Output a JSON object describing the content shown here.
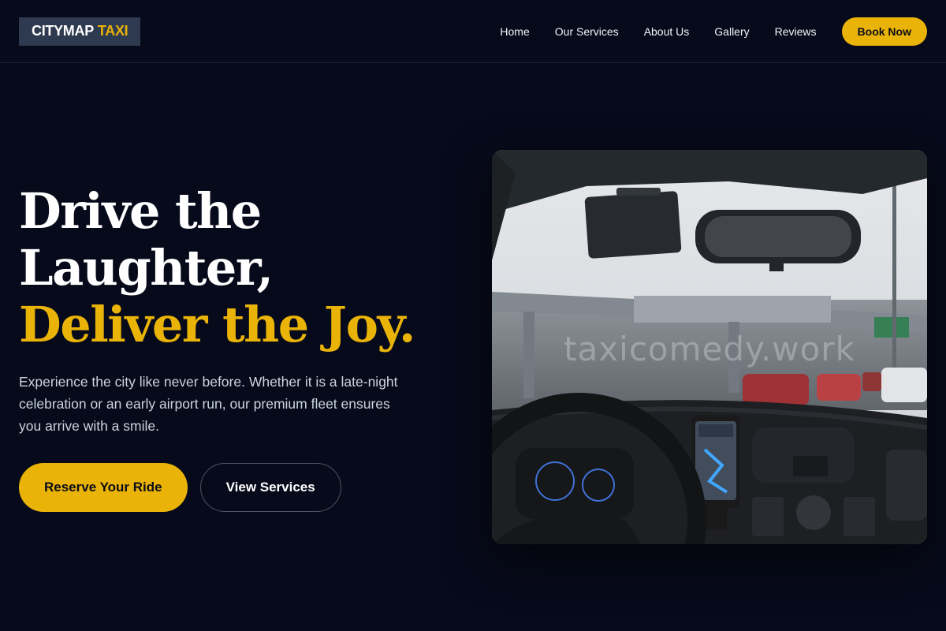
{
  "brand": {
    "name_part1": "CITYMAP",
    "name_part2": "TAXI"
  },
  "nav": {
    "links": [
      "Home",
      "Our Services",
      "About Us",
      "Gallery",
      "Reviews"
    ],
    "book_now": "Book Now"
  },
  "hero": {
    "line1": "Drive the",
    "line2": "Laughter,",
    "line3": "Deliver the Joy.",
    "description": "Experience the city like never before. Whether it is a late-night celebration or an early airport run, our premium fleet ensures you arrive with a smile.",
    "primary_cta": "Reserve Your Ride",
    "secondary_cta": "View Services",
    "image_watermark": "taxicomedy.work"
  },
  "colors": {
    "background": "#070a1a",
    "accent": "#eab308",
    "logo_bg": "#2e3a50"
  }
}
